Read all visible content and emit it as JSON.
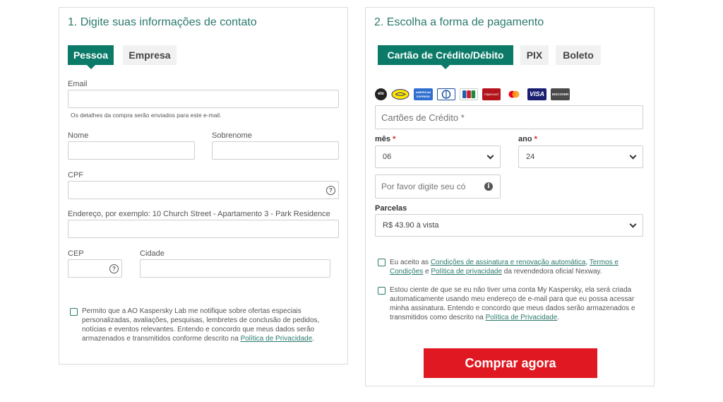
{
  "contact": {
    "title": "1. Digite suas informações de contato",
    "tabs": {
      "person": "Pessoa",
      "company": "Empresa"
    },
    "email": {
      "label": "Email",
      "value": "",
      "hint": "Os detalhes da compra serão enviados para este e-mail."
    },
    "first_name": {
      "label": "Nome",
      "value": ""
    },
    "last_name": {
      "label": "Sobrenome",
      "value": ""
    },
    "cpf": {
      "label": "CPF",
      "value": "",
      "help_icon": "question-circle-icon"
    },
    "address": {
      "label": "Endereço, por exemplo: 10 Church Street - Apartamento 3 - Park Residence",
      "value": ""
    },
    "cep": {
      "label": "CEP",
      "value": "",
      "help_icon": "question-circle-icon"
    },
    "city": {
      "label": "Cidade",
      "value": ""
    },
    "consent": {
      "text": "Permito que a AO Kaspersky Lab me notifique sobre ofertas especiais personalizadas, avaliações, pesquisas, lembretes de conclusão de pedidos, notícias e eventos relevantes. Entendo e concordo que meus dados serão armazenados e transmitidos conforme descrito na ",
      "link": "Política de Privacidade",
      "end": "."
    }
  },
  "payment": {
    "title": "2. Escolha a forma de pagamento",
    "tabs": {
      "card": "Cartão de Crédito/Débito",
      "pix": "PIX",
      "boleto": "Boleto"
    },
    "card_logos": [
      "elo",
      "mercado-pago",
      "american-express",
      "diners",
      "jcb",
      "hipercard",
      "mastercard",
      "visa",
      "discover"
    ],
    "card_logo_labels": {
      "amex": "AMERICAN EXPRESS",
      "hipercard": "Hipercard",
      "visa": "VISA",
      "discover": "DISCOVER",
      "elo": "elo"
    },
    "card_number": {
      "placeholder": "Cartões de Crédito *"
    },
    "month": {
      "label": "mês",
      "required_mark": "*",
      "value": "06"
    },
    "year": {
      "label": "ano",
      "required_mark": "*",
      "value": "24"
    },
    "cvv": {
      "placeholder": "Por favor digite seu có",
      "info_icon": "info-circle-icon"
    },
    "installments": {
      "label": "Parcelas",
      "value": "R$ 43.90 à vista"
    },
    "terms": {
      "prefix": "Eu aceito as ",
      "link1": "Condições de assinatura e renovação automática",
      "sep": ", ",
      "link2": "Termos e Condições",
      "and": " e ",
      "link3": "Política de privacidade",
      "suffix": " da revendedora oficial Nexway."
    },
    "account_notice": {
      "text": "Estou ciente de que se eu não tiver uma conta My Kaspersky, ela será criada automaticamente usando meu endereço de e-mail para que eu possa acessar minha assinatura. Entendo e concordo que meus dados serão armazenados e transmitidos como descrito na ",
      "link": "Política de Privacidade",
      "end": "."
    },
    "buy_button": "Comprar agora"
  },
  "colors": {
    "accent": "#0b7a68",
    "title": "#2b7a6e",
    "buy": "#e01822"
  }
}
